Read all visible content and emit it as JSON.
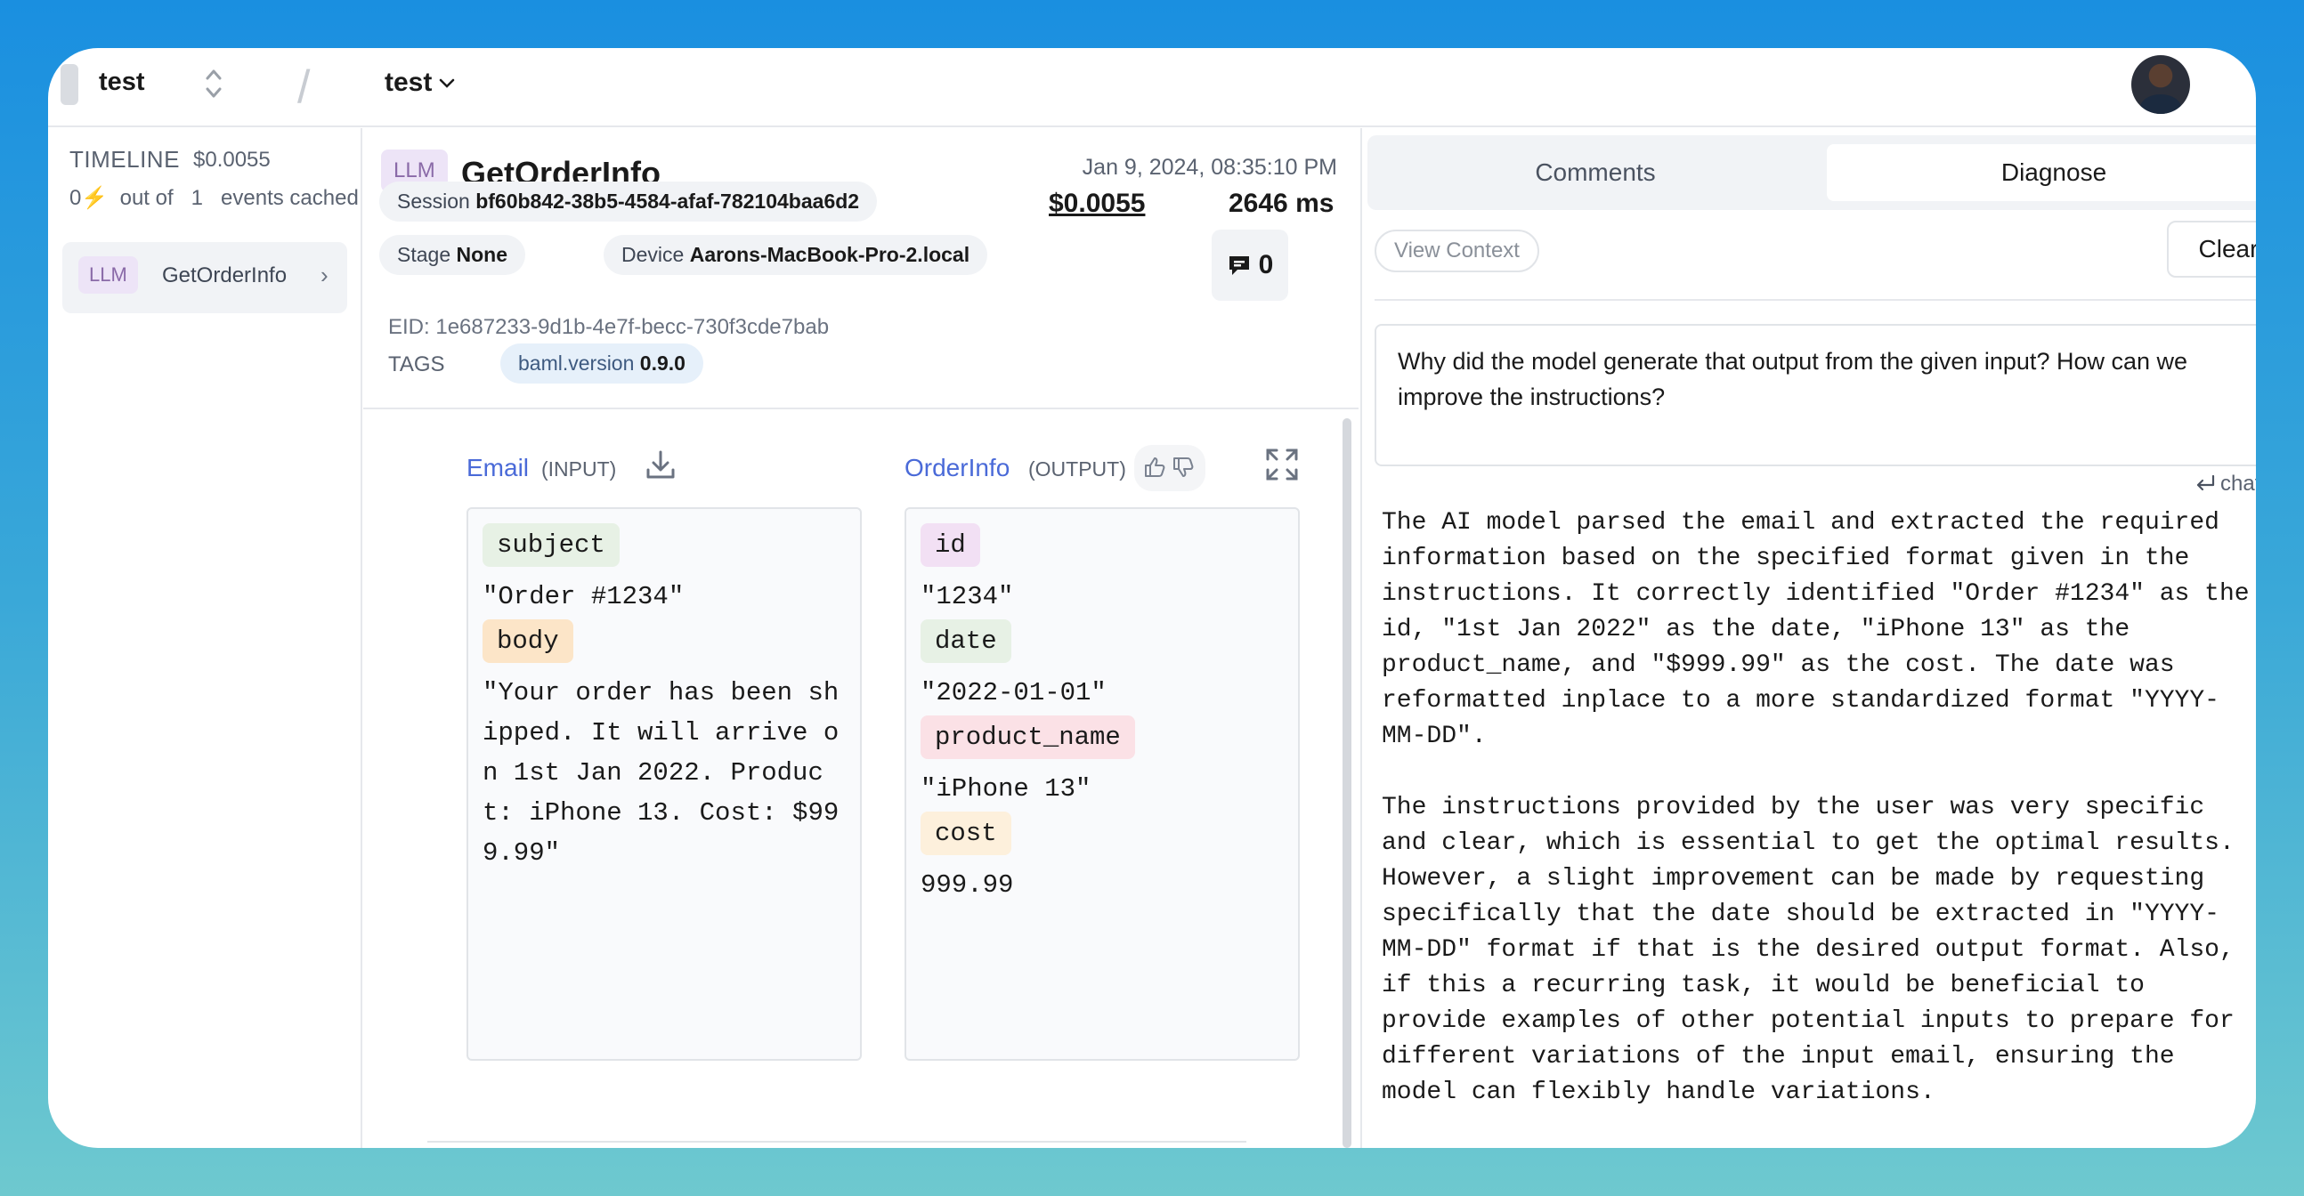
{
  "header": {
    "project": "test",
    "project2": "test",
    "separator": "/"
  },
  "sidebar": {
    "timeline_label": "TIMELINE",
    "timeline_cost": "$0.0055",
    "cached_count": "0",
    "cached_out_of": "out of",
    "cached_total": "1",
    "cached_suffix": "events cached",
    "items": [
      {
        "badge": "LLM",
        "label": "GetOrderInfo"
      }
    ]
  },
  "event": {
    "badge": "LLM",
    "title": "GetOrderInfo",
    "timestamp": "Jan 9, 2024, 08:35:10 PM",
    "cost": "$0.0055",
    "duration": "2646 ms",
    "comment_count": "0",
    "session_label": "Session",
    "session_value": "bf60b842-38b5-4584-afaf-782104baa6d2",
    "stage_label": "Stage",
    "stage_value": "None",
    "device_label": "Device",
    "device_value": "Aarons-MacBook-Pro-2.local",
    "eid": "EID: 1e687233-9d1b-4e7f-becc-730f3cde7bab",
    "tags_label": "TAGS",
    "tag_key": "baml.version",
    "tag_value": "0.9.0"
  },
  "input": {
    "title": "Email",
    "sub": "(INPUT)",
    "fields": [
      {
        "key": "subject",
        "value": "\"Order #1234\""
      },
      {
        "key": "body",
        "lines": [
          "\"Your order has been sh",
          "ipped. It will arrive o",
          "n 1st Jan 2022. Produc",
          "t: iPhone 13. Cost: $99",
          "9.99\""
        ]
      }
    ]
  },
  "output": {
    "title": "OrderInfo",
    "sub": "(OUTPUT)",
    "fields": [
      {
        "key": "id",
        "value": "\"1234\""
      },
      {
        "key": "date",
        "value": "\"2022-01-01\""
      },
      {
        "key": "product_name",
        "value": "\"iPhone 13\""
      },
      {
        "key": "cost",
        "value": "999.99"
      }
    ]
  },
  "diagnose": {
    "tabs": [
      "Comments",
      "Diagnose"
    ],
    "active_tab": "Diagnose",
    "view_context": "View Context",
    "clear": "Clear",
    "prompt": "Why did the model generate that output from the given input? How can we improve the instructions?",
    "chat_hint": "chat",
    "answer": "The AI model parsed the email and extracted the required\ninformation based on the specified format given in the\ninstructions. It correctly identified \"Order #1234\" as the\nid, \"1st Jan 2022\" as the date, \"iPhone 13\" as the\nproduct_name, and \"$999.99\" as the cost. The date was\nreformatted inplace to a more standardized format \"YYYY-\nMM-DD\".\n\nThe instructions provided by the user was very specific\nand clear, which is essential to get the optimal results.\nHowever, a slight improvement can be made by requesting\nspecifically that the date should be extracted in \"YYYY-\nMM-DD\" format if that is the desired output format. Also,\nif this a recurring task, it would be beneficial to\nprovide examples of other potential inputs to prepare for\ndifferent variations of the input email, ensuring the\nmodel can flexibly handle variations."
  }
}
